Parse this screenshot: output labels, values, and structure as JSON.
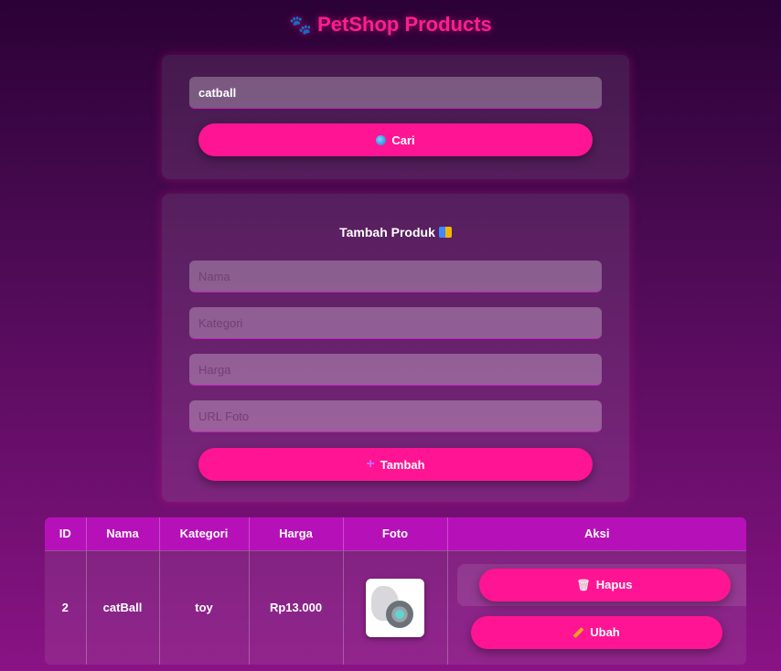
{
  "header": {
    "title": "PetShop Products",
    "icon": "paw-icon"
  },
  "search": {
    "value": "catball",
    "button_label": "Cari",
    "button_icon": "magnifier-icon"
  },
  "add_form": {
    "heading": "Tambah Produk",
    "heading_icon": "books-icon",
    "fields": [
      {
        "placeholder": "Nama",
        "value": ""
      },
      {
        "placeholder": "Kategori",
        "value": ""
      },
      {
        "placeholder": "Harga",
        "value": ""
      },
      {
        "placeholder": "URL Foto",
        "value": ""
      }
    ],
    "button_label": "Tambah",
    "button_icon": "plus-icon"
  },
  "table": {
    "columns": [
      "ID",
      "Nama",
      "Kategori",
      "Harga",
      "Foto",
      "Aksi"
    ],
    "rows": [
      {
        "id": "2",
        "nama": "catBall",
        "kategori": "toy",
        "harga": "Rp13.000",
        "delete_label": "Hapus",
        "edit_label": "Ubah"
      }
    ]
  },
  "colors": {
    "accent": "#ff1493",
    "header_bg": "#b611b8",
    "title": "#ff1e8c"
  }
}
